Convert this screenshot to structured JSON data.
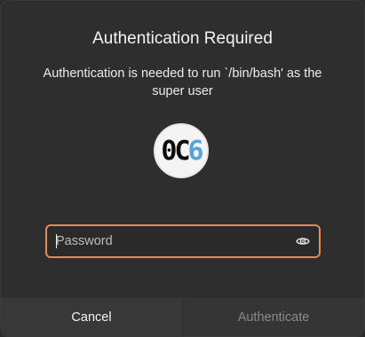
{
  "dialog": {
    "title": "Authentication Required",
    "message": "Authentication is needed to run `/bin/bash' as the super user",
    "avatar": {
      "text_dark": "0C",
      "text_blue": "6"
    },
    "password": {
      "placeholder": "Password",
      "value": ""
    },
    "reveal_icon": "eye-icon",
    "buttons": {
      "cancel_label": "Cancel",
      "authenticate_label": "Authenticate"
    },
    "colors": {
      "accent": "#e9885a",
      "background": "#2e2e2e",
      "disabled_text": "#8a8a8a"
    }
  }
}
